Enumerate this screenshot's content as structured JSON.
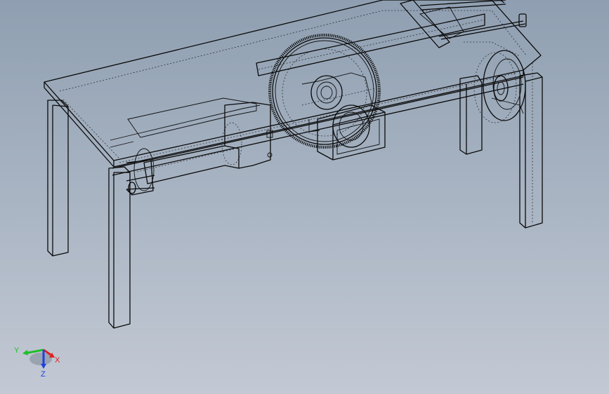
{
  "view": {
    "background_top": "#8f9fb1",
    "background_bottom": "#c3c9d4",
    "display_style": "wireframe-hidden-lines-visible"
  },
  "triad": {
    "x_label": "X",
    "y_label": "Y",
    "z_label": "Z",
    "x_color": "#e02020",
    "y_color": "#1fbf2a",
    "z_color": "#2040e0"
  }
}
